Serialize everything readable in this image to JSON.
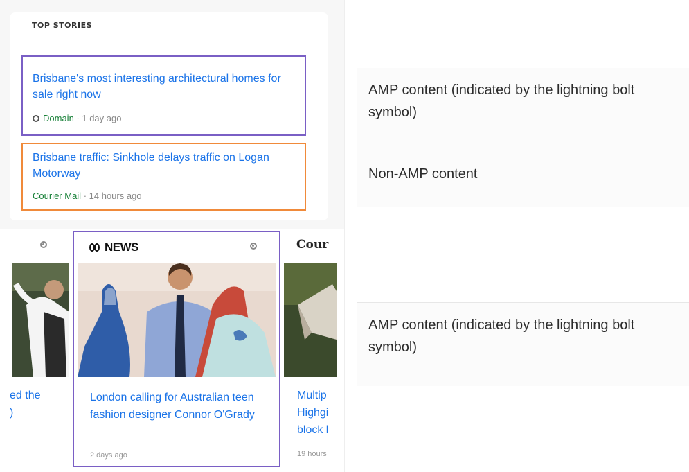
{
  "top_stories": {
    "title": "TOP STORIES",
    "items": [
      {
        "headline": "Brisbane's most interesting architectural homes for sale right now",
        "source": "Domain",
        "time": "1 day ago",
        "amp": true
      },
      {
        "headline": "Brisbane traffic: Sinkhole delays traffic on Logan Motorway",
        "source": "Courier Mail",
        "time": "14 hours ago",
        "amp": false
      }
    ]
  },
  "carousel": {
    "left_card": {
      "caption_line1": "ed the",
      "caption_line2": "​)"
    },
    "news_card": {
      "publisher": "NEWS",
      "caption": "London calling for Australian teen fashion designer Connor O'Grady",
      "time": "2 days ago"
    },
    "right_card": {
      "publisher": "Cour",
      "caption_lines": [
        "Multip",
        "Highgi",
        "block l"
      ],
      "time": "19 hours"
    }
  },
  "legend": {
    "amp_top": "AMP content (indicated by the lightning bolt symbol)",
    "non_amp": "Non-AMP content",
    "amp_bottom": "AMP content (indicated by the lightning bolt symbol)"
  },
  "colors": {
    "amp_border": "#7a5fc5",
    "non_amp_border": "#f08a3a",
    "link_blue": "#1a73e8",
    "source_green": "#188038"
  }
}
